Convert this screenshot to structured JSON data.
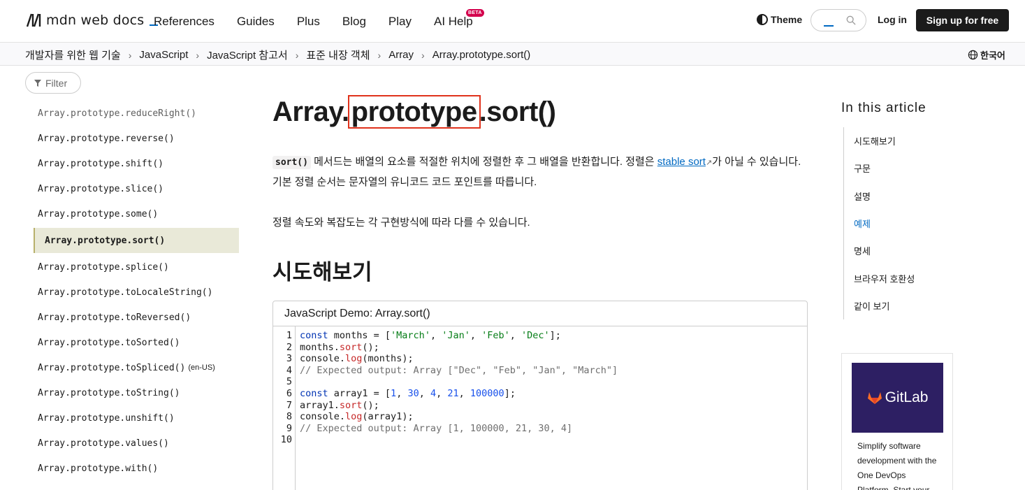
{
  "header": {
    "logo_text": "mdn web docs",
    "nav": [
      {
        "label": "References"
      },
      {
        "label": "Guides"
      },
      {
        "label": "Plus"
      },
      {
        "label": "Blog"
      },
      {
        "label": "Play"
      },
      {
        "label": "AI Help",
        "badge": "BETA"
      }
    ],
    "theme_label": "Theme",
    "login_label": "Log in",
    "signup_label": "Sign up for free"
  },
  "breadcrumb": {
    "items": [
      "개발자를 위한 웹 기술",
      "JavaScript",
      "JavaScript 참고서",
      "표준 내장 객체",
      "Array",
      "Array.prototype.sort()"
    ],
    "language": "한국어"
  },
  "sidebar": {
    "filter_label": "Filter",
    "items": [
      {
        "label": "Array.prototype.reduceRight()"
      },
      {
        "label": "Array.prototype.reverse()"
      },
      {
        "label": "Array.prototype.shift()"
      },
      {
        "label": "Array.prototype.slice()"
      },
      {
        "label": "Array.prototype.some()"
      },
      {
        "label": "Array.prototype.sort()"
      },
      {
        "label": "Array.prototype.splice()"
      },
      {
        "label": "Array.prototype.toLocaleString()"
      },
      {
        "label": "Array.prototype.toReversed()"
      },
      {
        "label": "Array.prototype.toSorted()"
      },
      {
        "label": "Array.prototype.toSpliced()",
        "tag": "(en-US)"
      },
      {
        "label": "Array.prototype.toString()"
      },
      {
        "label": "Array.prototype.unshift()"
      },
      {
        "label": "Array.prototype.values()"
      },
      {
        "label": "Array.prototype.with()"
      }
    ]
  },
  "main": {
    "title_prefix": "Array.",
    "title_highlight": "prototype",
    "title_suffix": ".sort()",
    "intro_code": "sort()",
    "intro_text_1": " 메서드는 배열의 요소를 적절한 위치에 정렬한 후 그 배열을 반환합니다. 정렬은 ",
    "intro_link": "stable sort",
    "intro_text_2": "가 아닐 수 있습니다. 기본 정렬 순서는 문자열의 유니코드 코드 포인트를 따릅니다.",
    "para2": "정렬 속도와 복잡도는 각 구현방식에 따라 다를 수 있습니다.",
    "section_title": "시도해보기",
    "demo_title": "JavaScript Demo: Array.sort()",
    "line_numbers": [
      "1",
      "2",
      "3",
      "4",
      "5",
      "6",
      "7",
      "8",
      "9",
      "10"
    ]
  },
  "toc": {
    "title": "In this article",
    "items": [
      "시도해보기",
      "구문",
      "설명",
      "예제",
      "명세",
      "브라우저 호환성",
      "같이 보기"
    ],
    "current": "예제"
  },
  "ad": {
    "brand": "GitLab",
    "text": "Simplify software development with the One DevOps Platform. Start your"
  },
  "colors": {
    "accent": "#0069c2",
    "highlight_box": "#e0321c",
    "sidebar_active_bg": "#e9e9d8",
    "ad_bg": "#2d1f63"
  }
}
